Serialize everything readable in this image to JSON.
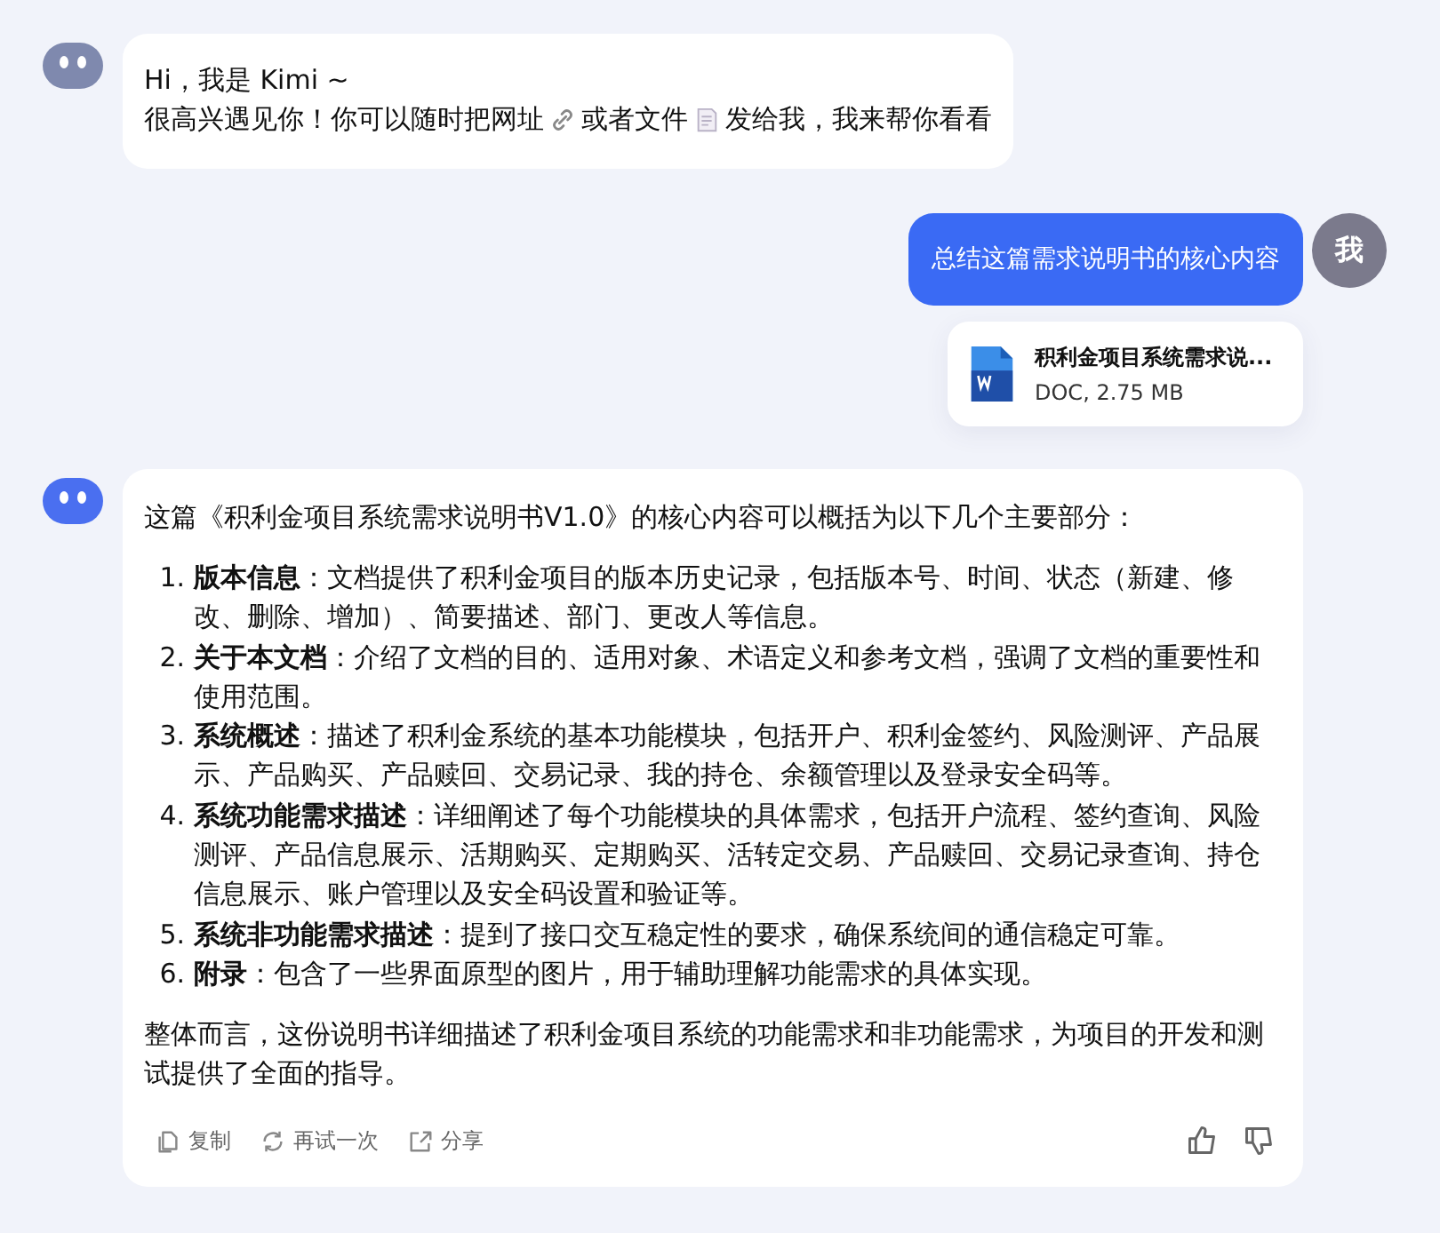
{
  "messages": [
    {
      "kind": "greeting",
      "lines": [
        {
          "segments": [
            {
              "kind": "text",
              "text": "Hi，我是 Kimi ~"
            }
          ]
        },
        {
          "segments": [
            {
              "kind": "text",
              "text": "很高兴遇见你！你可以随时把网址"
            },
            {
              "kind": "link-icon"
            },
            {
              "kind": "text",
              "text": "或者文件"
            },
            {
              "kind": "doc-icon"
            },
            {
              "kind": "text",
              "text": "发给我，我来帮你看看"
            }
          ]
        }
      ]
    },
    {
      "kind": "prompt",
      "avatar": "我",
      "text": "总结这篇需求说明书的核心内容",
      "attachment": {
        "name": "积利金项目系统需求说...",
        "meta": "DOC, 2.75 MB"
      }
    },
    {
      "kind": "answer",
      "intro": "这篇《积利金项目系统需求说明书V1.0》的核心内容可以概括为以下几个主要部分：",
      "items": [
        {
          "number": "1.",
          "text": "**版本信息**：文档提供了积利金项目的版本历史记录，包括版本号、时间、状态（新建、修改、删除、增加）、简要描述、部门、更改人等信息。"
        },
        {
          "number": "2.",
          "text": "**关于本文档**：介绍了文档的目的、适用对象、术语定义和参考文档，强调了文档的重要性和使用范围。"
        },
        {
          "number": "3.",
          "text": "**系统概述**：描述了积利金系统的基本功能模块，包括开户、积利金签约、风险测评、产品展示、产品购买、产品赎回、交易记录、我的持仓、余额管理以及登录安全码等。"
        },
        {
          "number": "4.",
          "text": "**系统功能需求描述**：详细阐述了每个功能模块的具体需求，包括开户流程、签约查询、风险测评、产品信息展示、活期购买、定期购买、活转定交易、产品赎回、交易记录查询、持仓信息展示、账户管理以及安全码设置和验证等。"
        },
        {
          "number": "5.",
          "text": "**系统非功能需求描述**：提到了接口交互稳定性的要求，确保系统间的通信稳定可靠。"
        },
        {
          "number": "6.",
          "text": "**附录**：包含了一些界面原型的图片，用于辅助理解功能需求的具体实现。"
        }
      ],
      "summary": "整体而言，这份说明书详细描述了积利金项目系统的功能需求和非功能需求，为项目的开发和测试提供了全面的指导。",
      "actions": [
        {
          "kind": "copy",
          "label": "复制"
        },
        {
          "kind": "retry",
          "label": "再试一次"
        },
        {
          "kind": "share",
          "label": "分享"
        }
      ],
      "feedback": [
        {
          "kind": "like"
        },
        {
          "kind": "dislike"
        }
      ]
    }
  ]
}
